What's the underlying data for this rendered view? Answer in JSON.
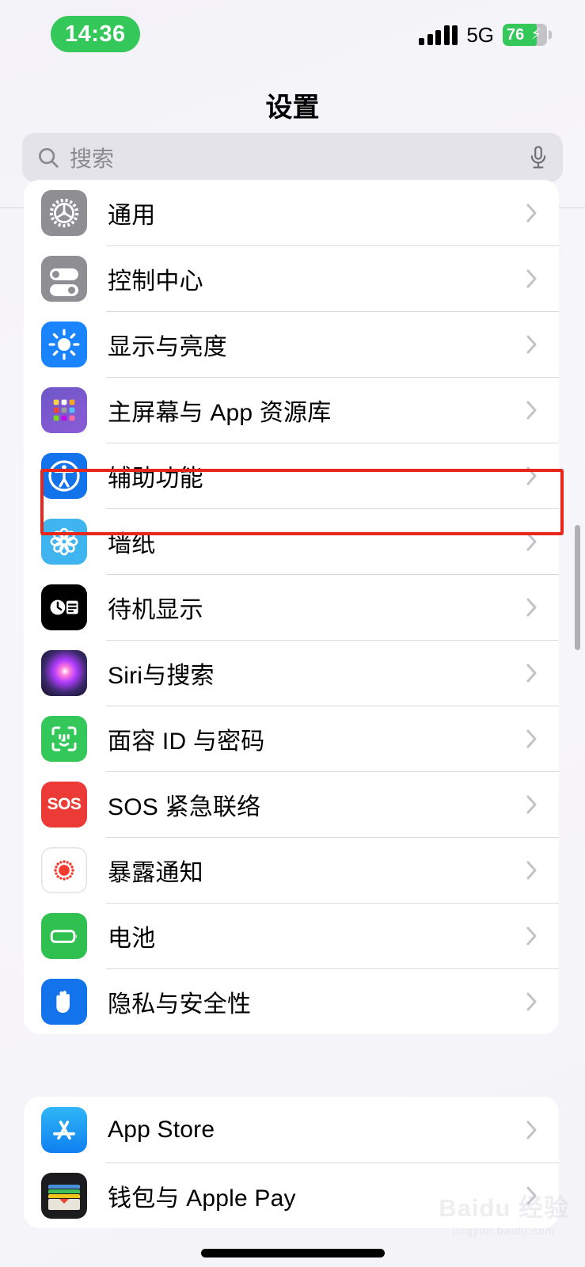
{
  "status_bar": {
    "time": "14:36",
    "network_label": "5G",
    "battery_percent": "76",
    "battery_charging": true,
    "battery_color": "#34c759",
    "time_pill_color": "#34c759",
    "signal_bars": 5
  },
  "nav": {
    "title": "设置"
  },
  "search": {
    "placeholder": "搜索",
    "value": ""
  },
  "highlight": {
    "color": "#e8261c",
    "target_label": "辅助功能"
  },
  "groups": [
    {
      "id": "group-1",
      "rows": [
        {
          "label": "通用",
          "icon": "gear-icon",
          "icon_class": "ic-gear",
          "chevron": "chevron-right-icon"
        },
        {
          "label": "控制中心",
          "icon": "control-center-icon",
          "icon_class": "ic-control",
          "chevron": "chevron-right-icon"
        },
        {
          "label": "显示与亮度",
          "icon": "brightness-icon",
          "icon_class": "ic-display",
          "chevron": "chevron-right-icon"
        },
        {
          "label": "主屏幕与 App 资源库",
          "icon": "home-screen-icon",
          "icon_class": "ic-home",
          "chevron": "chevron-right-icon"
        },
        {
          "label": "辅助功能",
          "icon": "accessibility-icon",
          "icon_class": "ic-access",
          "chevron": "chevron-right-icon"
        },
        {
          "label": "墙纸",
          "icon": "wallpaper-icon",
          "icon_class": "ic-wallpaper",
          "chevron": "chevron-right-icon"
        },
        {
          "label": "待机显示",
          "icon": "standby-icon",
          "icon_class": "ic-standby",
          "chevron": "chevron-right-icon"
        },
        {
          "label": "Siri与搜索",
          "icon": "siri-icon",
          "icon_class": "ic-siri",
          "chevron": "chevron-right-icon"
        },
        {
          "label": "面容 ID 与密码",
          "icon": "face-id-icon",
          "icon_class": "ic-faceid",
          "chevron": "chevron-right-icon"
        },
        {
          "label": "SOS 紧急联络",
          "icon": "sos-icon",
          "icon_class": "ic-sos",
          "chevron": "chevron-right-icon"
        },
        {
          "label": "暴露通知",
          "icon": "exposure-icon",
          "icon_class": "ic-exposure",
          "chevron": "chevron-right-icon"
        },
        {
          "label": "电池",
          "icon": "battery-icon",
          "icon_class": "ic-battery",
          "chevron": "chevron-right-icon"
        },
        {
          "label": "隐私与安全性",
          "icon": "privacy-hand-icon",
          "icon_class": "ic-privacy",
          "chevron": "chevron-right-icon"
        }
      ]
    },
    {
      "id": "group-2",
      "rows": [
        {
          "label": "App Store",
          "icon": "app-store-icon",
          "icon_class": "ic-appstore",
          "chevron": "chevron-right-icon"
        },
        {
          "label": "钱包与 Apple Pay",
          "icon": "wallet-icon",
          "icon_class": "ic-wallet",
          "chevron": "chevron-right-icon"
        }
      ]
    }
  ],
  "watermark": {
    "main": "Baidu 经验",
    "sub": "jingyan.baidu.com"
  }
}
